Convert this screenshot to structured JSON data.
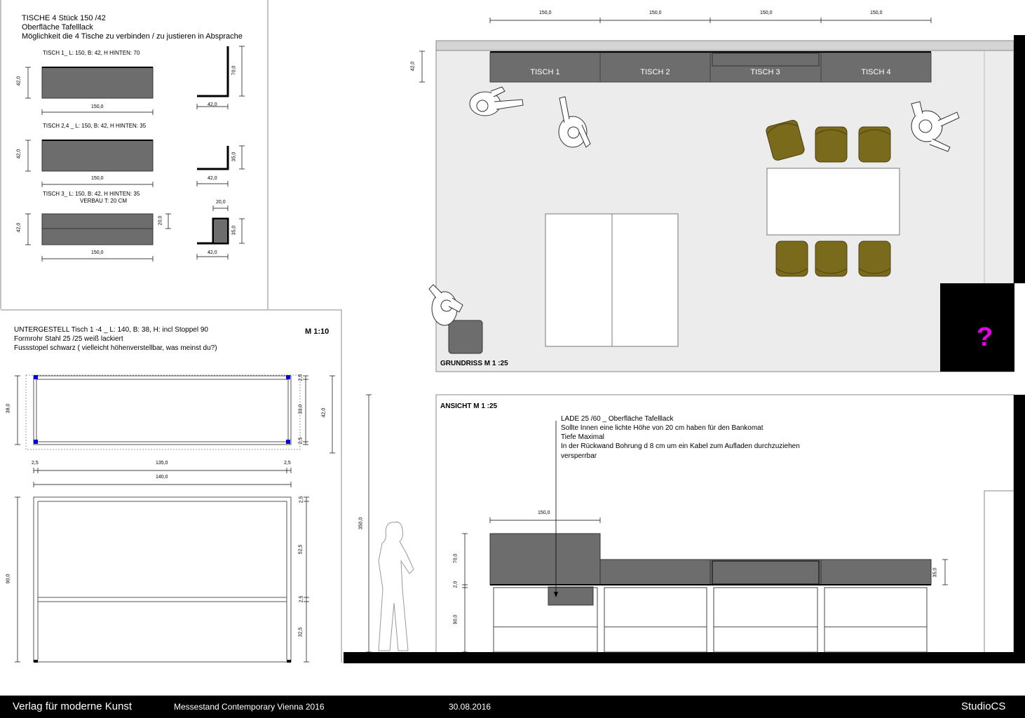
{
  "tables_panel": {
    "title": "TISCHE 4 Stück 150 /42",
    "line2": "Oberfläche Tafelllack",
    "line3": "Möglichkeit die 4 Tische zu verbinden / zu justieren in Absprache",
    "t1_label": "TISCH 1_  L: 150, B: 42, H HINTEN: 70",
    "t24_label": "TISCH 2,4 _  L: 150, B: 42, H HINTEN: 35",
    "t3_label": "TISCH 3_  L: 150, B: 42, H HINTEN: 35",
    "t3_label2": "VERBAU T: 20 CM",
    "dims": {
      "d150": "150,0",
      "d42": "42,0",
      "d70": "70,0",
      "d35": "35,0",
      "d20": "20,0"
    }
  },
  "frame_panel": {
    "title": "UNTERGESTELL  Tisch 1 -4 _ L: 140, B: 38, H: incl Stoppel 90",
    "line2": "Formrohr Stahl 25 /25 weiß lackiert",
    "line3": "Fussstopel  schwarz ( vielleicht höhenverstellbar, was meinst du?)",
    "scale": "M 1:10",
    "dims": {
      "d38": "38,0",
      "d25": "2,5",
      "d33": "33,0",
      "d42": "42,0",
      "d135": "135,0",
      "d140": "140,0",
      "d90": "90,0",
      "d525": "52,5",
      "d325": "32,5"
    }
  },
  "plan": {
    "label": "GRUNDRISS M 1 :25",
    "tables": [
      "TISCH 1",
      "TISCH 2",
      "TISCH 3",
      "TISCH 4"
    ],
    "dim_top": "150,0",
    "dim_depth": "42,0",
    "question": "?",
    "colors": {
      "table": "#6d6d6d",
      "chair": "#7a6a1c",
      "floor": "#ececec",
      "question": "#e400e4"
    }
  },
  "elevation": {
    "label": "ANSICHT M 1 :25",
    "note1": "LADE 25 /60 _ Oberfläche Tafelllack",
    "note2": "Sollte Innen eine lichte Höhe von 20 cm haben für den Bankomat",
    "note3": "Tiefe Maximal",
    "note4": "In der Rückwand Bohrung d 8 cm um ein Kabel zum Aufladen durchzuziehen",
    "note5": "versperrbar",
    "dims": {
      "d150": "150,0",
      "d350": "350,0",
      "d70": "70,0",
      "d2": "2,0",
      "d90": "90,0",
      "d35": "35,0"
    }
  },
  "footer": {
    "publisher": "Verlag für moderne Kunst",
    "project": "Messestand Contemporary Vienna 2016",
    "date": "30.08.2016",
    "studio": "StudioCS"
  }
}
